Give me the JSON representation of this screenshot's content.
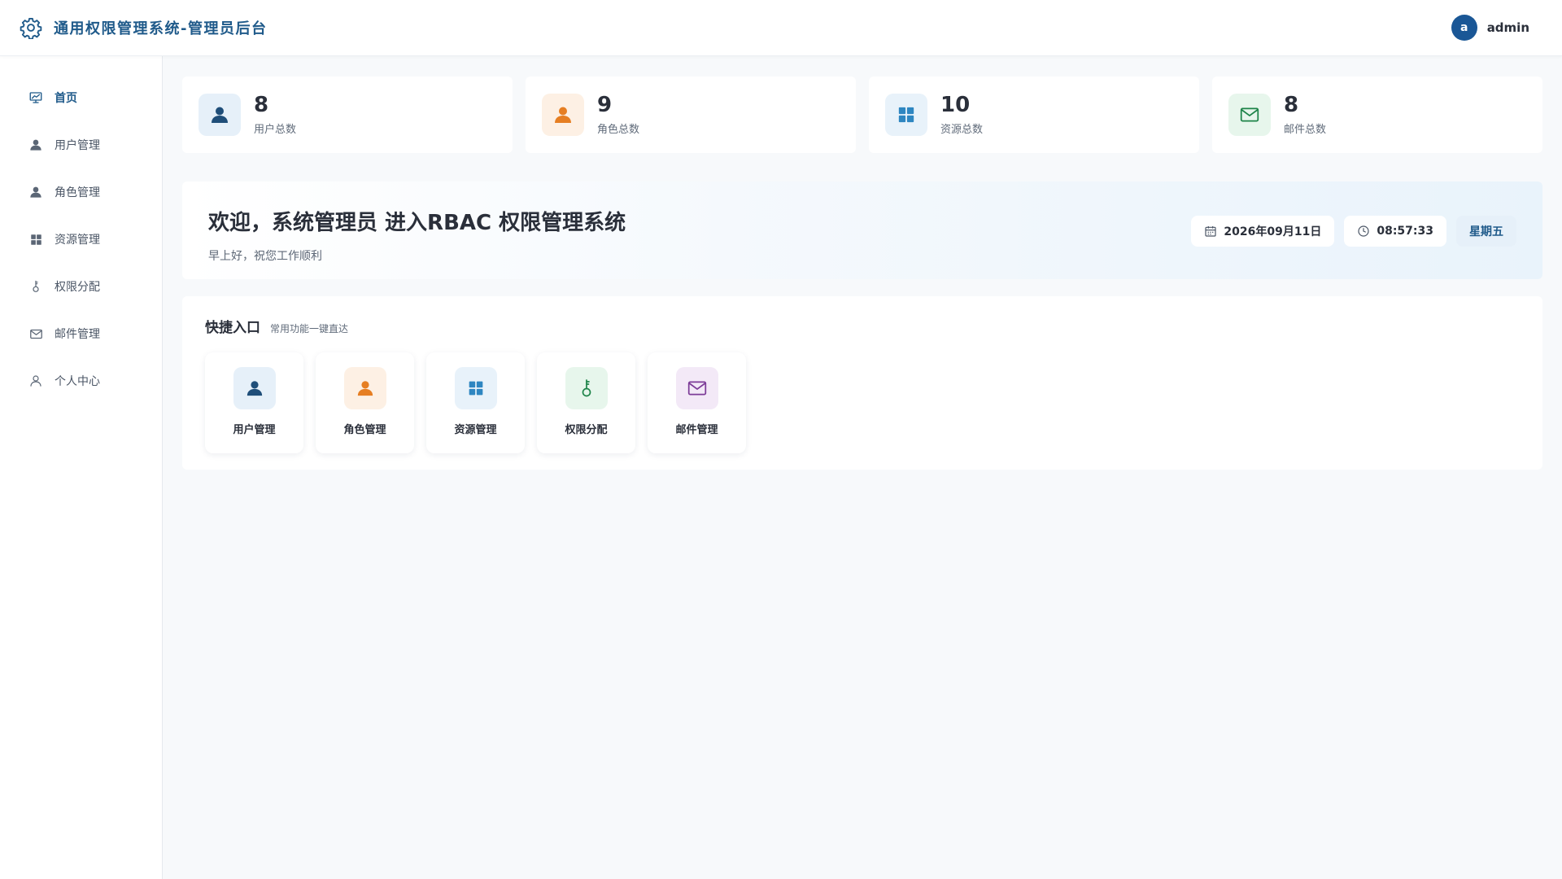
{
  "header": {
    "title": "通用权限管理系统-管理员后台",
    "avatar_letter": "a",
    "username": "admin"
  },
  "sidebar": {
    "items": [
      {
        "label": "首页",
        "icon": "dashboard-chart-icon",
        "active": true
      },
      {
        "label": "用户管理",
        "icon": "user-icon"
      },
      {
        "label": "角色管理",
        "icon": "user-icon"
      },
      {
        "label": "资源管理",
        "icon": "grid-icon"
      },
      {
        "label": "权限分配",
        "icon": "key-icon"
      },
      {
        "label": "邮件管理",
        "icon": "mail-icon"
      },
      {
        "label": "个人中心",
        "icon": "user-outline-icon"
      }
    ]
  },
  "stats": [
    {
      "value": "8",
      "label": "用户总数",
      "icon": "user-icon",
      "color": "#1f4e79",
      "bg": "#e6f0f9"
    },
    {
      "value": "9",
      "label": "角色总数",
      "icon": "user-icon",
      "color": "#e67e22",
      "bg": "#fdf0e4"
    },
    {
      "value": "10",
      "label": "资源总数",
      "icon": "grid-icon",
      "color": "#2e86c1",
      "bg": "#e8f2fa"
    },
    {
      "value": "8",
      "label": "邮件总数",
      "icon": "mail-icon",
      "color": "#1e8449",
      "bg": "#e7f6ec"
    }
  ],
  "welcome": {
    "title": "欢迎，系统管理员 进入RBAC 权限管理系统",
    "subtitle": "早上好，祝您工作顺利",
    "date": "2026年09月11日",
    "time": "08:57:33",
    "weekday": "星期五"
  },
  "quick": {
    "title": "快捷入口",
    "subtitle": "常用功能一键直达",
    "items": [
      {
        "label": "用户管理",
        "icon": "user-icon",
        "color": "#1f4e79",
        "bg": "#e6f0f9"
      },
      {
        "label": "角色管理",
        "icon": "user-icon",
        "color": "#e67e22",
        "bg": "#fdf0e4"
      },
      {
        "label": "资源管理",
        "icon": "grid-icon",
        "color": "#2e86c1",
        "bg": "#e8f2fa"
      },
      {
        "label": "权限分配",
        "icon": "key-icon",
        "color": "#1e8449",
        "bg": "#e7f6ec"
      },
      {
        "label": "邮件管理",
        "icon": "mail-icon",
        "color": "#7d3c98",
        "bg": "#f3e9f7"
      }
    ]
  },
  "colors": {
    "brand": "#1f5a8a",
    "avatar": "#1a5796",
    "page_bg": "#f7f9fb"
  }
}
